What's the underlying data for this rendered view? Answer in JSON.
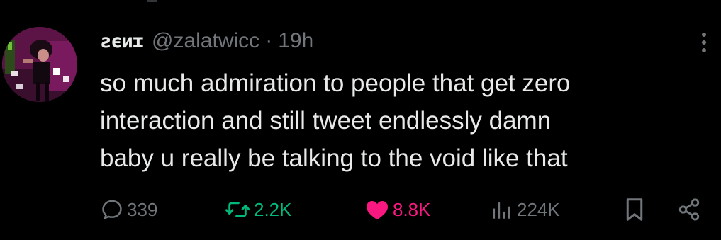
{
  "tweet": {
    "author": {
      "display_name": "ƨϵиɪ",
      "handle": "@zalatwicc",
      "avatar_icon": "avatar-photo"
    },
    "separator": "·",
    "time": "19h",
    "text_lines": [
      "so much admiration to people that get zero",
      "interaction and still tweet endlessly damn",
      "baby u really be talking to the void like that"
    ],
    "actions": {
      "reply": {
        "count": "339",
        "icon": "reply-icon"
      },
      "retweet": {
        "count": "2.2K",
        "icon": "retweet-icon",
        "active": true
      },
      "like": {
        "count": "8.8K",
        "icon": "heart-icon",
        "active": true
      },
      "views": {
        "count": "224K",
        "icon": "analytics-icon"
      },
      "bookmark": {
        "icon": "bookmark-icon"
      },
      "share": {
        "icon": "share-icon"
      }
    }
  },
  "colors": {
    "background": "#000000",
    "text": "#e7e9ea",
    "muted": "#71767b",
    "retweet_active": "#00ba7c",
    "like_active": "#f91880"
  }
}
